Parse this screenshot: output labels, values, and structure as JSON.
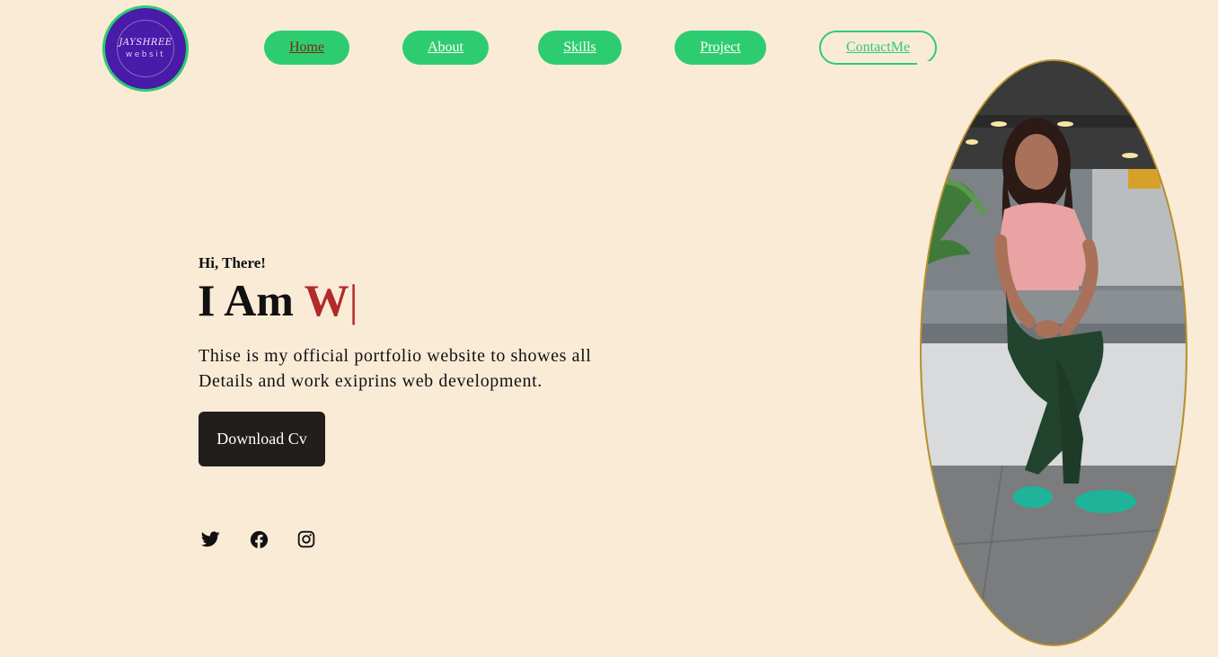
{
  "logo": {
    "line1": "JAYSHREE",
    "line2": "websit"
  },
  "nav": {
    "home": "Home",
    "about": "About",
    "skills": "Skills",
    "project": "Project",
    "contact": "ContactMe"
  },
  "hero": {
    "greeting": "Hi, There!",
    "title_prefix": "I Am ",
    "title_typed": "W",
    "title_cursor": "|",
    "description": "Thise is my official portfolio website to showes all Details and work exiprins web development.",
    "cv_button": "Download Cv"
  },
  "social": {
    "icons": [
      "twitter-icon",
      "facebook-icon",
      "instagram-icon"
    ]
  },
  "colors": {
    "background": "#faebd7",
    "accent_green": "#2ecc71",
    "accent_red": "#b22a2a",
    "logo_purple": "#4a1aa8",
    "button_dark": "#211e1c"
  }
}
